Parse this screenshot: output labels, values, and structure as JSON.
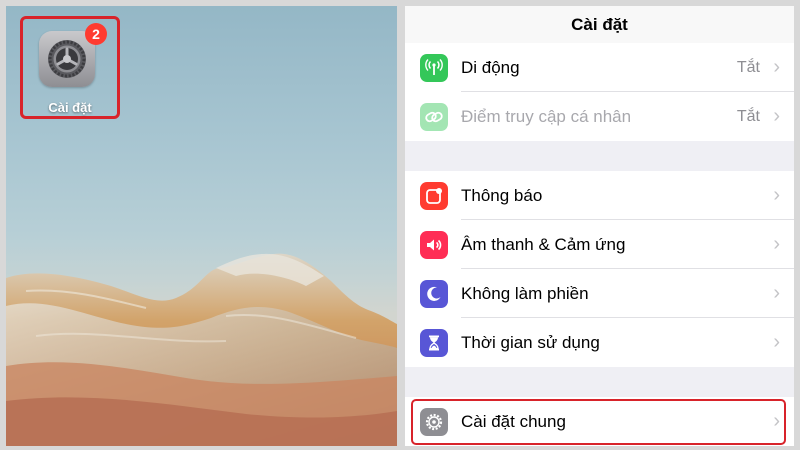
{
  "home_screen": {
    "app": {
      "label": "Cài đặt",
      "badge": "2",
      "icon": "settings-gear-icon"
    }
  },
  "settings": {
    "title": "Cài đặt",
    "groups": [
      {
        "rows": [
          {
            "label": "Di động",
            "value": "Tắt",
            "icon": "antenna-icon",
            "color": "#34c759"
          },
          {
            "label": "Điểm truy cập cá nhân",
            "value": "Tắt",
            "icon": "link-chain-icon",
            "color": "#34c759"
          }
        ]
      },
      {
        "rows": [
          {
            "label": "Thông báo",
            "icon": "notification-icon",
            "color": "#ff3b30"
          },
          {
            "label": "Âm thanh & Cảm ứng",
            "icon": "speaker-icon",
            "color": "#ff2d55"
          },
          {
            "label": "Không làm phiền",
            "icon": "moon-icon",
            "color": "#5856d6"
          },
          {
            "label": "Thời gian sử dụng",
            "icon": "hourglass-icon",
            "color": "#5856d6"
          }
        ]
      },
      {
        "rows": [
          {
            "label": "Cài đặt chung",
            "icon": "gear-icon",
            "color": "#8e8e93"
          }
        ]
      }
    ],
    "chevron": "›"
  },
  "highlight_color": "#d8232a"
}
